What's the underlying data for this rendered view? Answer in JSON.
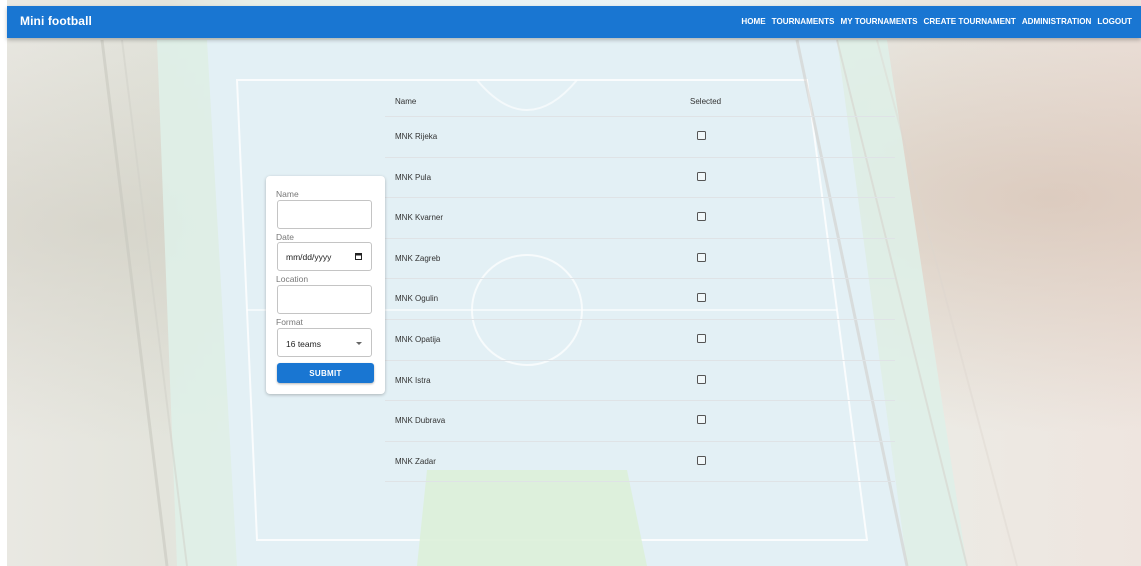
{
  "app": {
    "title": "Mini football"
  },
  "nav": {
    "items": [
      "HOME",
      "TOURNAMENTS",
      "MY TOURNAMENTS",
      "CREATE TOURNAMENT",
      "ADMINISTRATION",
      "LOGOUT"
    ]
  },
  "form": {
    "name_label": "Name",
    "name_value": "",
    "date_label": "Date",
    "date_placeholder": "mm/dd/yyyy",
    "location_label": "Location",
    "location_value": "",
    "format_label": "Format",
    "format_selected": "16 teams",
    "submit_label": "SUBMIT"
  },
  "table": {
    "headers": {
      "name": "Name",
      "selected": "Selected"
    },
    "rows": [
      {
        "name": "MNK Rijeka",
        "selected": false
      },
      {
        "name": "MNK Pula",
        "selected": false
      },
      {
        "name": "MNK Kvarner",
        "selected": false
      },
      {
        "name": "MNK Zagreb",
        "selected": false
      },
      {
        "name": "MNK Ogulin",
        "selected": false
      },
      {
        "name": "MNK Opatija",
        "selected": false
      },
      {
        "name": "MNK Istra",
        "selected": false
      },
      {
        "name": "MNK Dubrava",
        "selected": false
      },
      {
        "name": "MNK Zadar",
        "selected": false
      }
    ]
  },
  "colors": {
    "primary": "#1976d2"
  }
}
